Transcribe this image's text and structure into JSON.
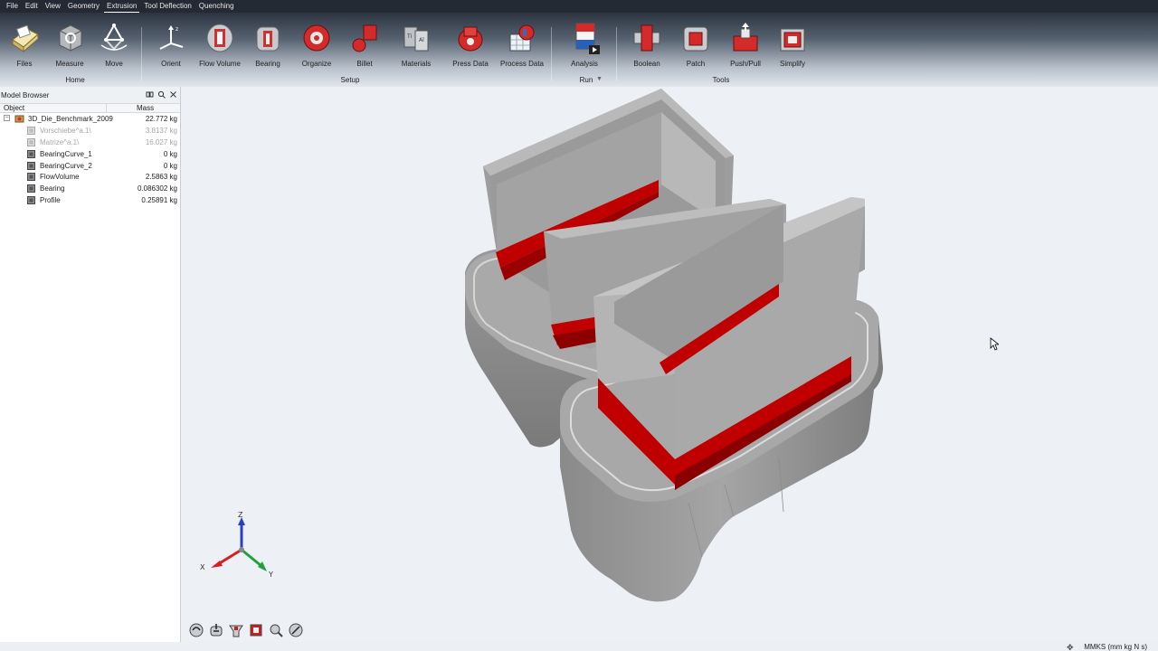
{
  "menu": [
    "File",
    "Edit",
    "View",
    "Geometry",
    "Extrusion",
    "Tool Deflection",
    "Quenching"
  ],
  "menu_active": "Extrusion",
  "ribbon": {
    "tools": [
      {
        "label": "Files",
        "icon": "files-icon"
      },
      {
        "label": "Measure",
        "icon": "measure-icon"
      },
      {
        "label": "Move",
        "icon": "move-icon"
      },
      {
        "label": "Orient",
        "icon": "orient-icon"
      },
      {
        "label": "Flow Volume",
        "icon": "flow-volume-icon"
      },
      {
        "label": "Bearing",
        "icon": "bearing-icon"
      },
      {
        "label": "Organize",
        "icon": "organize-icon"
      },
      {
        "label": "Billet",
        "icon": "billet-icon"
      },
      {
        "label": "Materials",
        "icon": "materials-icon"
      },
      {
        "label": "Press Data",
        "icon": "press-data-icon"
      },
      {
        "label": "Process Data",
        "icon": "process-data-icon"
      },
      {
        "label": "Analysis",
        "icon": "analysis-icon"
      },
      {
        "label": "Boolean",
        "icon": "boolean-icon"
      },
      {
        "label": "Patch",
        "icon": "patch-icon"
      },
      {
        "label": "Push/Pull",
        "icon": "push-pull-icon"
      },
      {
        "label": "Simplify",
        "icon": "simplify-icon"
      }
    ],
    "groups": {
      "home": "Home",
      "setup": "Setup",
      "run": "Run",
      "tools": "Tools"
    }
  },
  "browser": {
    "title": "Model Browser",
    "col_object": "Object",
    "col_mass": "Mass",
    "root": {
      "name": "3D_Die_Benchmark_2009",
      "mass": "22.772 kg"
    },
    "rows": [
      {
        "name": "Vorschiebe^a.1\\",
        "mass": "3.8137 kg",
        "dim": true
      },
      {
        "name": "Matrize^a.1\\",
        "mass": "16.027 kg",
        "dim": true
      },
      {
        "name": "BearingCurve_1",
        "mass": "0 kg",
        "dim": false
      },
      {
        "name": "BearingCurve_2",
        "mass": "0 kg",
        "dim": false
      },
      {
        "name": "FlowVolume",
        "mass": "2.5863 kg",
        "dim": false
      },
      {
        "name": "Bearing",
        "mass": "0.086302 kg",
        "dim": false
      },
      {
        "name": "Profile",
        "mass": "0.25891 kg",
        "dim": false
      }
    ]
  },
  "status": {
    "units": "MMKS (mm kg N s)"
  },
  "colors": {
    "bearing_red": "#c00000",
    "die_gray": "#9a9a9a",
    "ribbon_dark": "#2c3440"
  }
}
